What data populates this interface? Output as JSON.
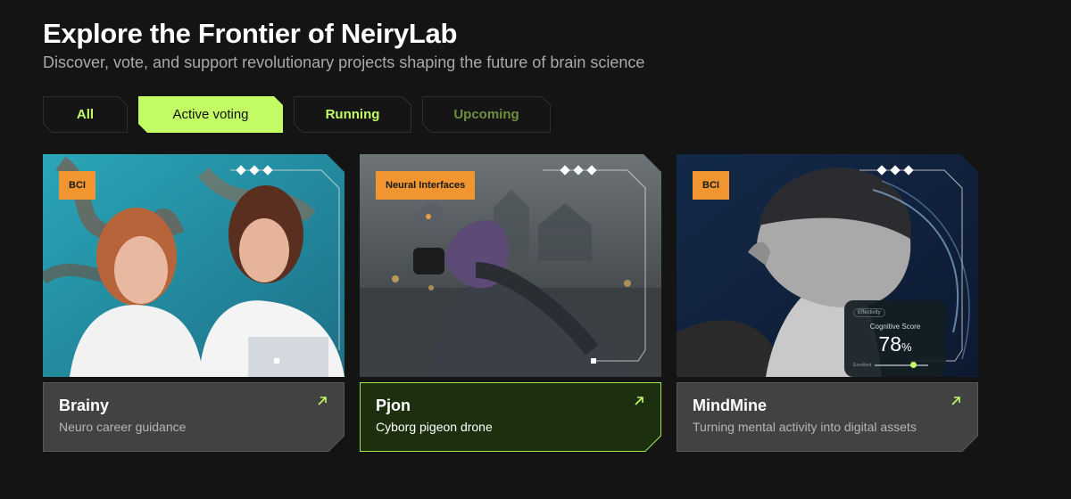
{
  "header": {
    "title": "Explore the Frontier of NeiryLab",
    "subtitle": "Discover, vote, and support revolutionary projects shaping the future of brain science"
  },
  "tabs": [
    {
      "label": "All",
      "state": "default"
    },
    {
      "label": "Active voting",
      "state": "selected"
    },
    {
      "label": "Running",
      "state": "default"
    },
    {
      "label": "Upcoming",
      "state": "muted"
    }
  ],
  "colors": {
    "accent": "#c2fb63",
    "badge": "#f0952f",
    "card_bg": "#424242",
    "active_card_bg": "#1c300f",
    "page_bg": "#141414"
  },
  "cards": [
    {
      "badge": "BCI",
      "title": "Brainy",
      "description": "Neuro career guidance",
      "image_alt": "two women looking at a laptop",
      "active": false
    },
    {
      "badge": "Neural Interfaces",
      "title": "Pjon",
      "description": "Cyborg pigeon drone",
      "image_alt": "pigeon with a camera device",
      "active": true
    },
    {
      "badge": "BCI",
      "title": "MindMine",
      "description": "Turning mental activity into digital assets",
      "image_alt": "person wearing a headset",
      "active": false,
      "overlay": {
        "chip": "Effectivity",
        "label": "Cognitive Score",
        "value": "78",
        "unit": "%",
        "footer": "Excellent"
      }
    }
  ]
}
